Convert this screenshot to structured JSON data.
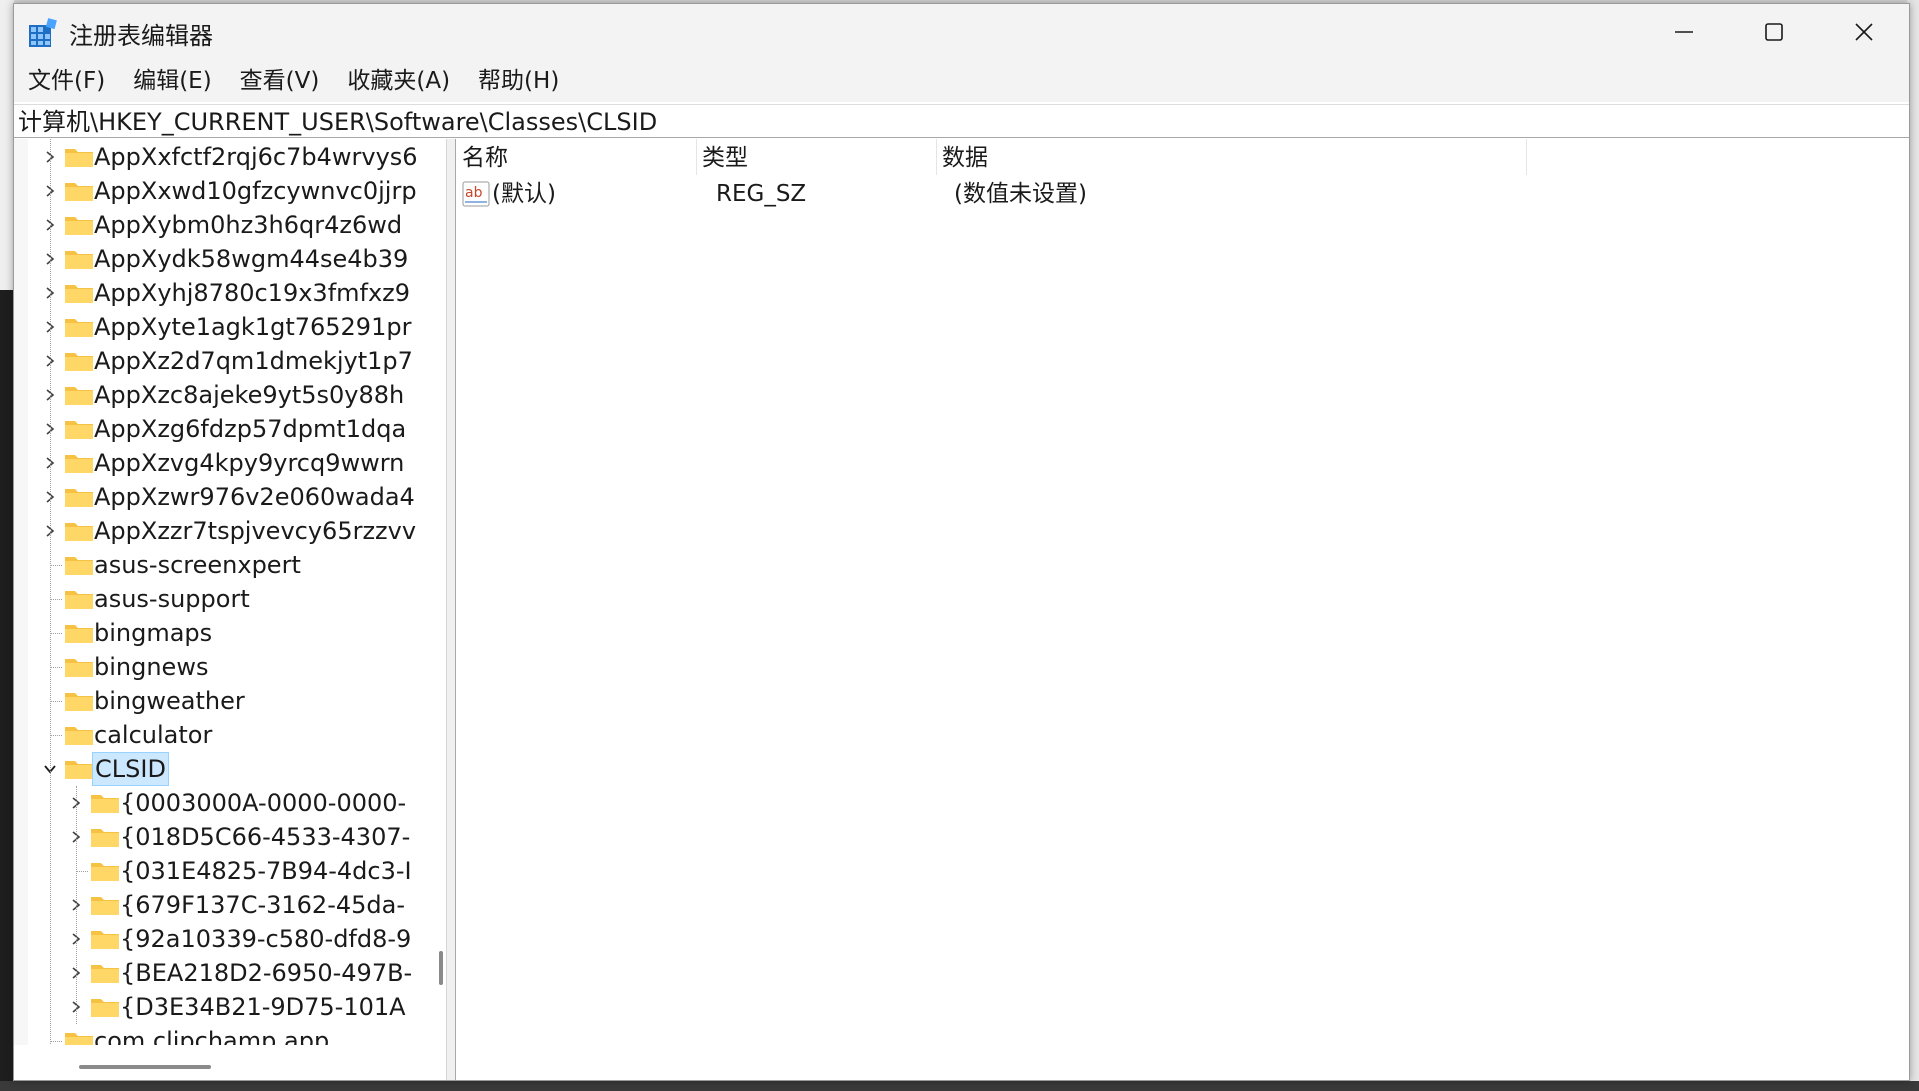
{
  "window": {
    "title": "注册表编辑器",
    "accent": "#0078d4"
  },
  "menu": [
    {
      "label": "文件(F)"
    },
    {
      "label": "编辑(E)"
    },
    {
      "label": "查看(V)"
    },
    {
      "label": "收藏夹(A)"
    },
    {
      "label": "帮助(H)"
    }
  ],
  "address": "计算机\\HKEY_CURRENT_USER\\Software\\Classes\\CLSID",
  "tree": {
    "items": [
      {
        "label": "AppXxfctf2rqj6c7b4wrvys6",
        "expandable": true
      },
      {
        "label": "AppXxwd10gfzcywnvc0jjrp",
        "expandable": true
      },
      {
        "label": "AppXybm0hz3h6qr4z6wd",
        "expandable": true
      },
      {
        "label": "AppXydk58wgm44se4b39",
        "expandable": true
      },
      {
        "label": "AppXyhj8780c19x3fmfxz9",
        "expandable": true
      },
      {
        "label": "AppXyte1agk1gt765291pr",
        "expandable": true
      },
      {
        "label": "AppXz2d7qm1dmekjyt1p7",
        "expandable": true
      },
      {
        "label": "AppXzc8ajeke9yt5s0y88h",
        "expandable": true
      },
      {
        "label": "AppXzg6fdzp57dpmt1dqa",
        "expandable": true
      },
      {
        "label": "AppXzvg4kpy9yrcq9wwrn",
        "expandable": true
      },
      {
        "label": "AppXzwr976v2e060wada4",
        "expandable": true
      },
      {
        "label": "AppXzzr7tspjvevcy65rzzvv",
        "expandable": true
      },
      {
        "label": "asus-screenxpert",
        "expandable": false
      },
      {
        "label": "asus-support",
        "expandable": false
      },
      {
        "label": "bingmaps",
        "expandable": false
      },
      {
        "label": "bingnews",
        "expandable": false
      },
      {
        "label": "bingweather",
        "expandable": false
      },
      {
        "label": "calculator",
        "expandable": false
      },
      {
        "label": "CLSID",
        "expandable": true,
        "expanded": true,
        "selected": true
      }
    ],
    "children": [
      {
        "label": "{0003000A-0000-0000-",
        "expandable": true
      },
      {
        "label": "{018D5C66-4533-4307-",
        "expandable": true
      },
      {
        "label": "{031E4825-7B94-4dc3-I",
        "expandable": false
      },
      {
        "label": "{679F137C-3162-45da-",
        "expandable": true
      },
      {
        "label": "{92a10339-c580-dfd8-9",
        "expandable": true
      },
      {
        "label": "{BEA218D2-6950-497B-",
        "expandable": true
      },
      {
        "label": "{D3E34B21-9D75-101A",
        "expandable": true
      }
    ],
    "after": [
      {
        "label": "com.clipchamp.app",
        "expandable": false
      }
    ]
  },
  "list": {
    "columns": [
      "名称",
      "类型",
      "数据"
    ],
    "rows": [
      {
        "name": "(默认)",
        "type": "REG_SZ",
        "data": "(数值未设置)",
        "icon": "string-value-icon"
      }
    ]
  }
}
